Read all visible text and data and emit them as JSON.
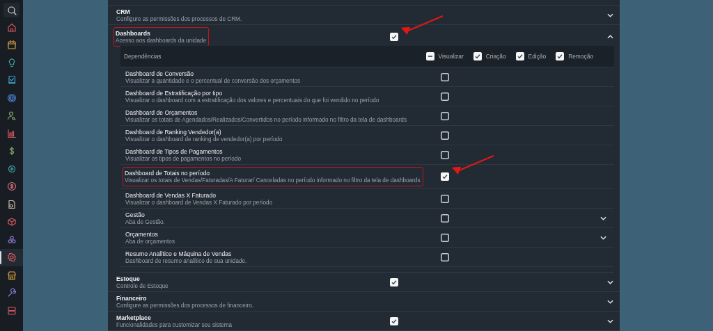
{
  "sidebar": {
    "items": [
      {
        "selected": false
      },
      {
        "selected": false
      },
      {
        "selected": false
      },
      {
        "selected": false
      },
      {
        "selected": false
      },
      {
        "selected": false
      },
      {
        "selected": false
      },
      {
        "selected": false
      },
      {
        "selected": false
      },
      {
        "selected": false
      },
      {
        "selected": false
      },
      {
        "selected": false
      },
      {
        "selected": false
      },
      {
        "selected": false
      },
      {
        "selected": true
      },
      {
        "selected": false
      },
      {
        "selected": false
      },
      {
        "selected": false
      }
    ]
  },
  "modules": [
    {
      "kind": "group",
      "title": "CRM",
      "description": "Configure as permissões dos processos de CRM.",
      "expanded": false,
      "highlighted": false,
      "arrow": false
    },
    {
      "kind": "permission",
      "title": "Dashboards",
      "description": "Acesso aos dashboards da unidade",
      "checked": true,
      "expanded": true,
      "highlighted": true,
      "arrow": true,
      "dependencies": {
        "label": "Dependências",
        "columns": [
          {
            "label": "Visualizar",
            "indeterminate": true
          },
          {
            "label": "Criação",
            "checked": true,
            "indeterminate": false
          },
          {
            "label": "Edição",
            "checked": true,
            "indeterminate": false
          },
          {
            "label": "Remoção",
            "checked": true,
            "indeterminate": false
          }
        ]
      },
      "children": [
        {
          "kind": "item",
          "title": "Dashboard de Conversão",
          "description": "Visualizar a quantidade e o percentual de conversão dos orçamentos",
          "checked": false,
          "highlighted": false,
          "arrow": false
        },
        {
          "kind": "item",
          "title": "Dashboard de Estratificação por tipo",
          "description": "Visualizar o dashboard com a estratificação dos valores e percentuais do que foi vendido no período",
          "checked": false,
          "highlighted": false,
          "arrow": false
        },
        {
          "kind": "item",
          "title": "Dashboard de Orçamentos",
          "description": "Visualizar os totais de Agendados/Realizados/Convertidos no período informado no filtro da tela de dashboards",
          "checked": false,
          "highlighted": false,
          "arrow": false
        },
        {
          "kind": "item",
          "title": "Dashboard de Ranking Vendedor(a)",
          "description": "Visualizar o dashboard de ranking de vendedor(a) por período",
          "checked": false,
          "highlighted": false,
          "arrow": false
        },
        {
          "kind": "item",
          "title": "Dashboard de Tipos de Pagamentos",
          "description": "Visualizar os tipos de pagamentos no período",
          "checked": false,
          "highlighted": false,
          "arrow": false
        },
        {
          "kind": "item",
          "title": "Dashboard de Totais no período",
          "description": "Visualizar os totais de Vendas/Faturadas/A Faturar/ Canceladas no período informado no filtro da tela de dashboards",
          "checked": true,
          "highlighted": true,
          "arrow": true
        },
        {
          "kind": "item",
          "title": "Dashboard de Vendas X Faturado",
          "description": "Visualizar o dashboard de Vendas X Faturado por período",
          "checked": false,
          "highlighted": false,
          "arrow": false
        },
        {
          "kind": "section",
          "title": "Gestão",
          "description": "Aba de Gestão.",
          "checked": false,
          "expanded": false,
          "highlighted": false,
          "arrow": false
        },
        {
          "kind": "section",
          "title": "Orçamentos",
          "description": "Aba de orçamentos",
          "checked": false,
          "expanded": false,
          "highlighted": false,
          "arrow": false
        },
        {
          "kind": "item",
          "title": "Resumo Analítico e Máquina de Vendas",
          "description": "Dashboard de resumo analítico de sua unidade.",
          "checked": false,
          "highlighted": false,
          "arrow": false
        }
      ]
    },
    {
      "kind": "permission",
      "title": "Estoque",
      "description": "Controle de Estoque",
      "checked": true,
      "expanded": false,
      "highlighted": false,
      "arrow": false
    },
    {
      "kind": "group",
      "title": "Financeiro",
      "description": "Configure as permissões dos processos de financeiro.",
      "expanded": false,
      "highlighted": false,
      "arrow": false
    },
    {
      "kind": "permission",
      "title": "Marketplace",
      "description": "Funcionalidades para customizar seu sistema",
      "checked": true,
      "expanded": false,
      "highlighted": false,
      "arrow": false
    }
  ]
}
